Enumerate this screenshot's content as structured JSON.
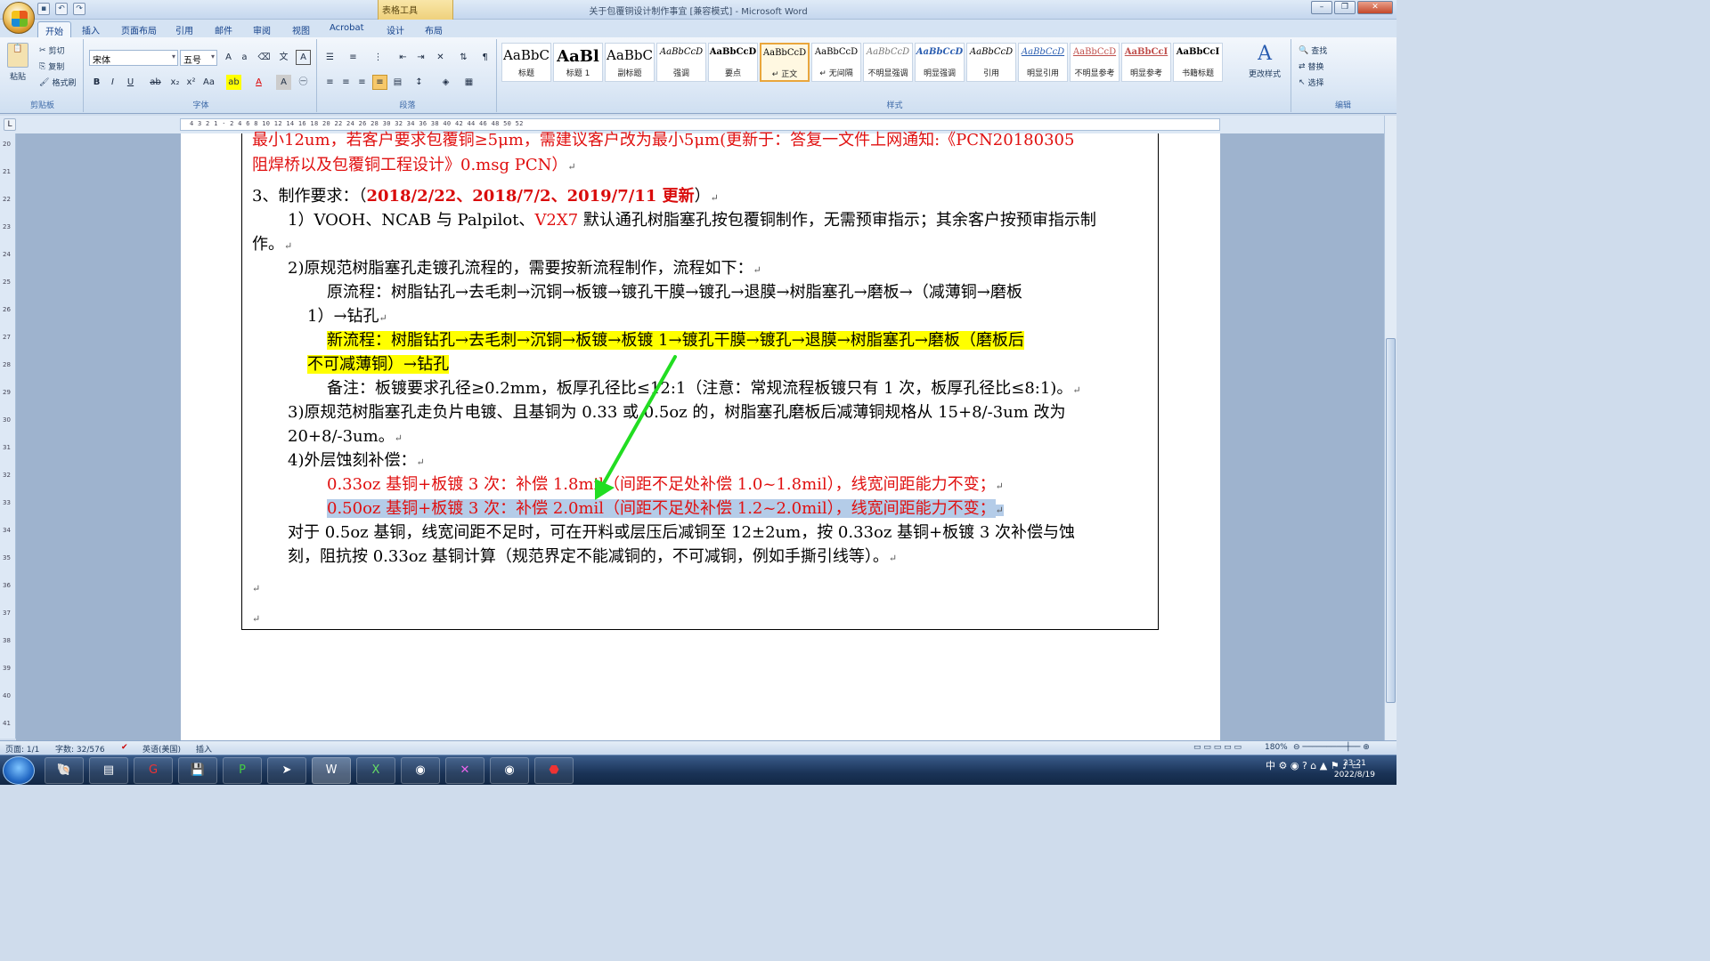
{
  "window": {
    "title": "关于包覆铜设计制作事宜 [兼容模式] - Microsoft Word",
    "context_tab": "表格工具"
  },
  "tabs": [
    "开始",
    "插入",
    "页面布局",
    "引用",
    "邮件",
    "审阅",
    "视图",
    "Acrobat",
    "设计",
    "布局"
  ],
  "clipboard": {
    "paste": "粘贴",
    "cut": "剪切",
    "copy": "复制",
    "format_painter": "格式刷",
    "label": "剪贴板"
  },
  "font": {
    "name": "宋体",
    "size": "五号",
    "label": "字体"
  },
  "paragraph": {
    "label": "段落"
  },
  "styles": {
    "label": "样式",
    "change": "更改样式",
    "items": [
      {
        "preview": "AaBbC",
        "name": "标题"
      },
      {
        "preview": "AaBl",
        "name": "标题 1"
      },
      {
        "preview": "AaBbC",
        "name": "副标题"
      },
      {
        "preview": "AaBbCcD",
        "name": "强调"
      },
      {
        "preview": "AaBbCcD",
        "name": "要点"
      },
      {
        "preview": "AaBbCcD",
        "name": "↵ 正文"
      },
      {
        "preview": "AaBbCcD",
        "name": "↵ 无间隔"
      },
      {
        "preview": "AaBbCcD",
        "name": "不明显强调"
      },
      {
        "preview": "AaBbCcD",
        "name": "明显强调"
      },
      {
        "preview": "AaBbCcD",
        "name": "引用"
      },
      {
        "preview": "AaBbCcD",
        "name": "明显引用"
      },
      {
        "preview": "AaBbCcD",
        "name": "不明显参考"
      },
      {
        "preview": "AaBbCcI",
        "name": "明显参考"
      },
      {
        "preview": "AaBbCcI",
        "name": "书籍标题"
      }
    ]
  },
  "editing": {
    "find": "查找",
    "replace": "替换",
    "select": "选择",
    "label": "编辑"
  },
  "ruler": {
    "marks": "4 3 2 1 · 2 4 6 8 10 12 14 16 18 20 22 24 26 28 30 32 34 36 38 40 42 44 46 48 50 52"
  },
  "vruler": [
    "20",
    "21",
    "22",
    "23",
    "24",
    "25",
    "26",
    "27",
    "28",
    "29",
    "30",
    "31",
    "32",
    "33",
    "34",
    "35",
    "36",
    "37",
    "38",
    "39",
    "40",
    "41"
  ],
  "doc": {
    "l1": "最小12um，若客户要求包覆铜≥5μm，需建议客户改为最小5μm(更新于：答复一文件上网通知:《PCN20180305",
    "l2": "阻焊桥以及包覆铜工程设计》0.msg  PCN）",
    "l3a": "3、制作要求：（",
    "l3b": "2018/2/22、2018/7/2、2019/7/11 更新",
    "l3c": "）",
    "l4a": "1）VOOH、NCAB 与 Palpilot、",
    "l4b": "V2X7",
    "l4c": " 默认通孔树脂塞孔按包覆铜制作，无需预审指示；其余客户按预审指示制",
    "l5": "作。",
    "l6": "2)原规范树脂塞孔走镀孔流程的，需要按新流程制作，流程如下：",
    "l7": "原流程：树脂钻孔→去毛刺→沉铜→板镀→镀孔干膜→镀孔→退膜→树脂塞孔→磨板→（减薄铜→磨板",
    "l8": "1）→钻孔",
    "l9": "新流程：树脂钻孔→去毛刺→沉铜→板镀→板镀 1→镀孔干膜→镀孔→退膜→树脂塞孔→磨板（磨板后",
    "l10": "不可减薄铜）→钻孔",
    "l11": "备注：板镀要求孔径≥0.2mm，板厚孔径比≤12:1（注意：常规流程板镀只有 1 次，板厚孔径比≤8:1)。",
    "l12": "3)原规范树脂塞孔走负片电镀、且基铜为 0.33 或 0.5oz 的，树脂塞孔磨板后减薄铜规格从 15+8/-3um 改为",
    "l13": "20+8/-3um。",
    "l14": "4)外层蚀刻补偿：",
    "l15": "0.33oz 基铜+板镀 3 次：补偿 1.8mil（间距不足处补偿 1.0~1.8mil），线宽间距能力不变；",
    "l16": "0.50oz 基铜+板镀 3 次：补偿 2.0mil（间距不足处补偿 1.2~2.0mil），线宽间距能力不变；",
    "l17": "对于 0.5oz 基铜，线宽间距不足时，可在开料或层压后减铜至 12±2um，按 0.33oz 基铜+板镀 3 次补偿与蚀",
    "l18": "刻，阻抗按 0.33oz 基铜计算（规范界定不能减铜的，不可减铜，例如手撕引线等）。"
  },
  "status": {
    "page": "页面: 1/1",
    "words": "字数: 32/576",
    "lang": "英语(美国)",
    "mode": "插入",
    "zoom": "180%"
  },
  "taskbar": {
    "tray": "中",
    "time": "23:21",
    "date": "2022/8/19"
  },
  "colors": {
    "highlight_yellow": "#ffff00",
    "selection_blue": "#b4cce8",
    "red_text": "#e01010",
    "arrow": "#22dd22"
  }
}
